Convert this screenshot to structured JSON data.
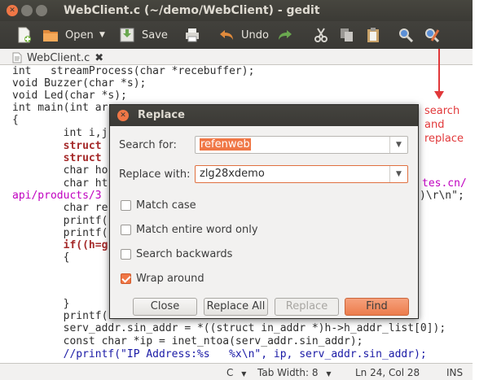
{
  "window": {
    "title": "WebClient.c (~/demo/WebClient) - gedit"
  },
  "toolbar": {
    "open_label": "Open",
    "save_label": "Save",
    "undo_label": "Undo"
  },
  "tab": {
    "label": "WebClient.c"
  },
  "code_lines": [
    "int   streamProcess(char *recebuffer);",
    "void Buzzer(char *s);",
    "void Led(char *s);",
    "int main(int ar",
    "{",
    "        int i,j",
    "        struct",
    "        struct",
    "        char ho",
    "        char ht",
    "api/products/3",
    "        char re",
    "        printf(",
    "        printf(",
    "        if((h=g",
    "        {",
    "",
    "",
    "        }",
    "        printf(",
    "        serv_addr.sin_addr = *((struct in_addr *)h->h_addr_list[0]);",
    "        const char *ip = inet_ntoa(serv_addr.sin_addr);",
    "        //printf(\"IP Address:%s   %x\\n\", ip, serv_addr.sin_addr);"
  ],
  "code_fragments": {
    "url_tail": "tes.cn/",
    "crlf_tail": ")\\r\\n\";"
  },
  "status": {
    "language": "C",
    "tab_width": "Tab Width: 8",
    "position": "Ln 24, Col 28",
    "mode": "INS"
  },
  "dialog": {
    "title": "Replace",
    "search_label": "Search for:",
    "search_value": "refenweb",
    "replace_label": "Replace with:",
    "replace_value": "zlg28xdemo",
    "options": [
      {
        "label": "Match case",
        "checked": false
      },
      {
        "label": "Match entire word only",
        "checked": false
      },
      {
        "label": "Search backwards",
        "checked": false
      },
      {
        "label": "Wrap around",
        "checked": true
      }
    ],
    "buttons": {
      "close": "Close",
      "replace_all": "Replace All",
      "replace": "Replace",
      "find": "Find"
    }
  },
  "annotation": {
    "text": "search and replace"
  },
  "colors": {
    "accent": "#f07746",
    "annotation": "#e1383a"
  }
}
